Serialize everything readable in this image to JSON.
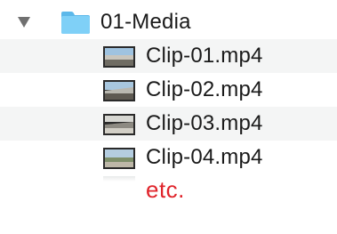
{
  "folder": {
    "name": "01-Media",
    "icon": "folder-icon",
    "expanded": true,
    "color": "#6ec6f2"
  },
  "files": [
    {
      "name": "Clip-01.mp4",
      "icon": "video-thumbnail-icon"
    },
    {
      "name": "Clip-02.mp4",
      "icon": "video-thumbnail-icon"
    },
    {
      "name": "Clip-03.mp4",
      "icon": "video-thumbnail-icon"
    },
    {
      "name": "Clip-04.mp4",
      "icon": "video-thumbnail-icon"
    }
  ],
  "more": {
    "label": "etc.",
    "color": "#e0242b"
  }
}
